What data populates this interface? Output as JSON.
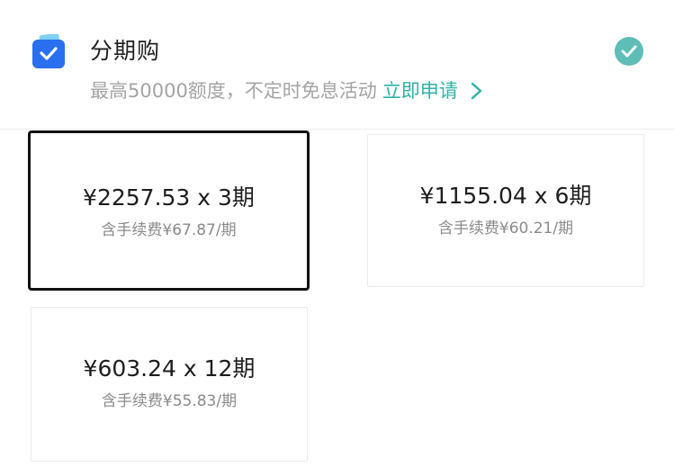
{
  "payment_method": {
    "icon": "wallet-check-icon",
    "title": "分期购",
    "description": "最高50000额度，不定时免息活动",
    "apply_link": "立即申请",
    "selected": true,
    "accent_color": "#2fb2a6",
    "icon_color": "#2a6ff0"
  },
  "plans": [
    {
      "amount": "¥2257.53 x 3期",
      "fee": "含手续费¥67.87/期",
      "selected": true
    },
    {
      "amount": "¥1155.04 x 6期",
      "fee": "含手续费¥60.21/期",
      "selected": false
    },
    {
      "amount": "¥603.24 x 12期",
      "fee": "含手续费¥55.83/期",
      "selected": false
    }
  ]
}
